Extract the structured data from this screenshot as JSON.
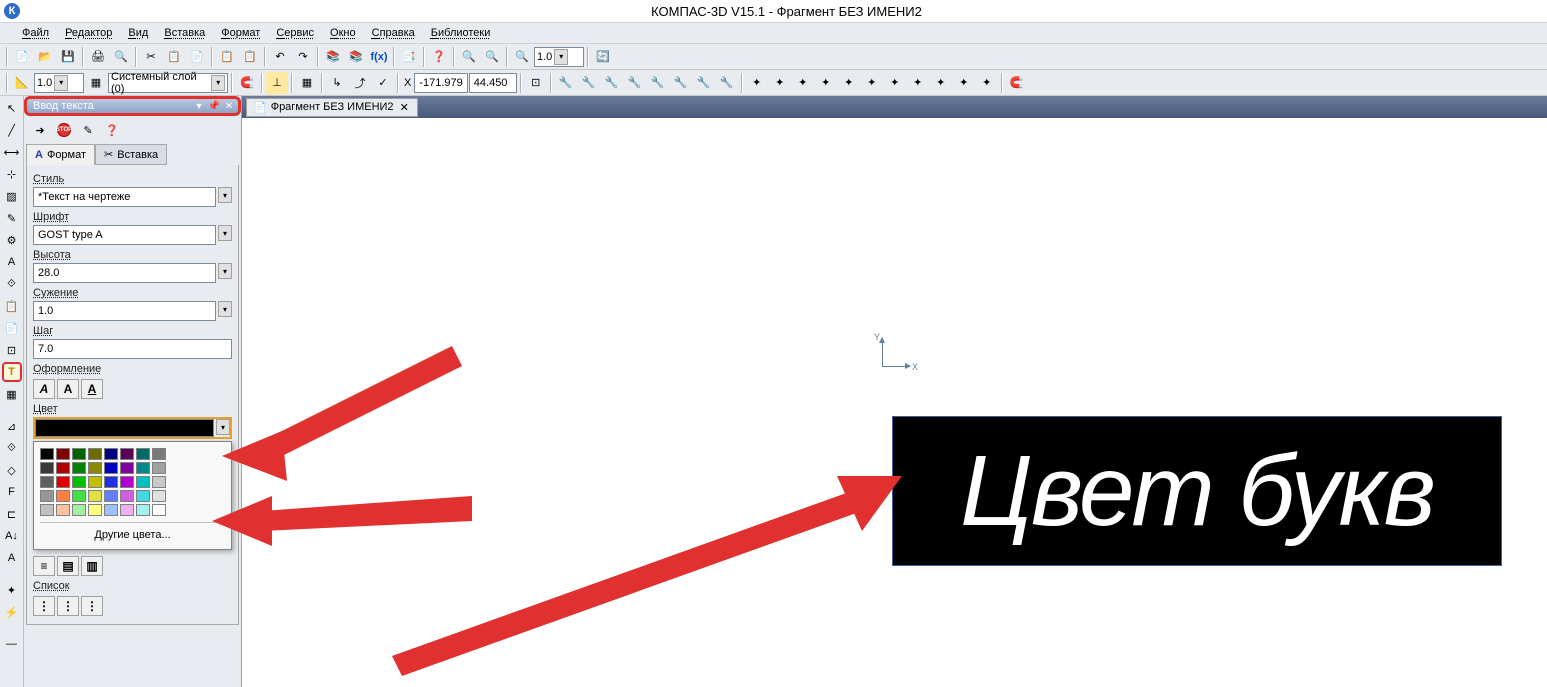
{
  "app": {
    "title": "КОМПАС-3D V15.1 - Фрагмент БЕЗ ИМЕНИ2",
    "icon_letter": "К"
  },
  "menu": {
    "file": "Файл",
    "editor": "Редактор",
    "view": "Вид",
    "insert": "Вставка",
    "format": "Формат",
    "service": "Сервис",
    "window": "Окно",
    "help": "Справка",
    "libraries": "Библиотеки"
  },
  "toolbar": {
    "zoom_combo": "1.0",
    "scale_combo": "1.0",
    "layer_combo": "Системный слой (0)",
    "coord_x_label": "X",
    "coord_x": "-171.979",
    "coord_y": "44.450"
  },
  "panel": {
    "title": "Ввод текста",
    "tab_format": "Формат",
    "tab_insert": "Вставка",
    "style_label": "Стиль",
    "style_value": "*Текст на чертеже",
    "font_label": "Шрифт",
    "font_value": "GOST type A",
    "height_label": "Высота",
    "height_value": "28.0",
    "narrow_label": "Сужение",
    "narrow_value": "1.0",
    "step_label": "Шаг",
    "step_value": "7.0",
    "decor_label": "Оформление",
    "color_label": "Цвет",
    "other_colors": "Другие цвета...",
    "list_label": "Список"
  },
  "doc_tab": {
    "name": "Фрагмент БЕЗ ИМЕНИ2"
  },
  "canvas": {
    "text": "Цвет букв",
    "axis_x": "X",
    "axis_y": "Y"
  },
  "color_palette": {
    "row1": [
      "#000000",
      "#7f0000",
      "#006400",
      "#6b6b00",
      "#000080",
      "#5a005a",
      "#006a6a",
      "#7a7a7a"
    ],
    "row2": [
      "#3a3a3a",
      "#b00000",
      "#008200",
      "#8a8a00",
      "#0000c0",
      "#8000a0",
      "#008a8a",
      "#a0a0a0"
    ],
    "row3": [
      "#606060",
      "#e00000",
      "#00c000",
      "#c0c000",
      "#2030e0",
      "#b000d0",
      "#00c0c0",
      "#c8c8c8"
    ],
    "row4": [
      "#969696",
      "#ff8040",
      "#40e040",
      "#e0e040",
      "#6080ff",
      "#d060e0",
      "#40d8e0",
      "#e0e0e0"
    ],
    "row5": [
      "#c0c0c0",
      "#ffc0a0",
      "#a0f0a0",
      "#ffff80",
      "#a0c0ff",
      "#f0b0f0",
      "#a0f0f0",
      "#ffffff"
    ]
  }
}
